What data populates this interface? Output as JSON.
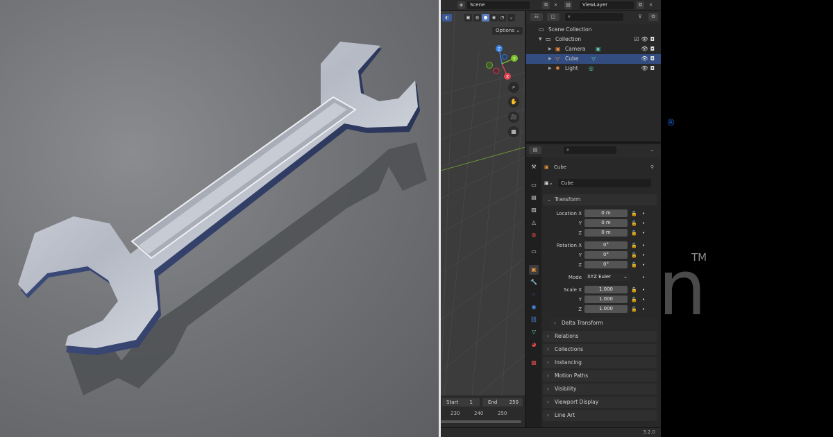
{
  "topbar": {
    "scene_label": "Scene",
    "viewlayer_label": "ViewLayer",
    "close_glyph": "×"
  },
  "viewport": {
    "options_label": "Options ⌄"
  },
  "timeline": {
    "start_label": "Start",
    "start_value": "1",
    "end_label": "End",
    "end_value": "250",
    "frame_numbers": [
      "230",
      "240",
      "250"
    ]
  },
  "outliner": {
    "search_placeholder": "",
    "scene_collection": "Scene Collection",
    "collection": "Collection",
    "items": [
      {
        "label": "Camera",
        "selected": false,
        "icon": "camera-icon"
      },
      {
        "label": "Cube",
        "selected": true,
        "icon": "mesh-icon"
      },
      {
        "label": "Light",
        "selected": false,
        "icon": "light-icon"
      }
    ]
  },
  "properties": {
    "object_name": "Cube",
    "data_name": "Cube",
    "transform_label": "Transform",
    "location_label": "Location X",
    "y_label": "Y",
    "z_label": "Z",
    "location": [
      "0 m",
      "0 m",
      "0 m"
    ],
    "rotation_label": "Rotation X",
    "rotation": [
      "0°",
      "0°",
      "0°"
    ],
    "mode_label": "Mode",
    "mode_value": "XYZ Euler",
    "scale_label": "Scale X",
    "scale": [
      "1.000",
      "1.000",
      "1.000"
    ],
    "delta_transform": "Delta Transform",
    "panels": [
      "Relations",
      "Collections",
      "Instancing",
      "Motion Paths",
      "Visibility",
      "Viewport Display",
      "Line Art"
    ]
  },
  "status": {
    "version": "3.2.0"
  },
  "background_marks": {
    "registered": "®",
    "trademark": "TM",
    "letter": "n"
  },
  "gizmo": {
    "z": "Z",
    "y": "Y",
    "x": "X"
  },
  "colors": {
    "accent": "#334d80",
    "viewport_bg": "#3c3c3c",
    "panel_bg": "#282828",
    "axis_x": "#e04452",
    "axis_y": "#7cc12d",
    "axis_z": "#3b82e0"
  }
}
